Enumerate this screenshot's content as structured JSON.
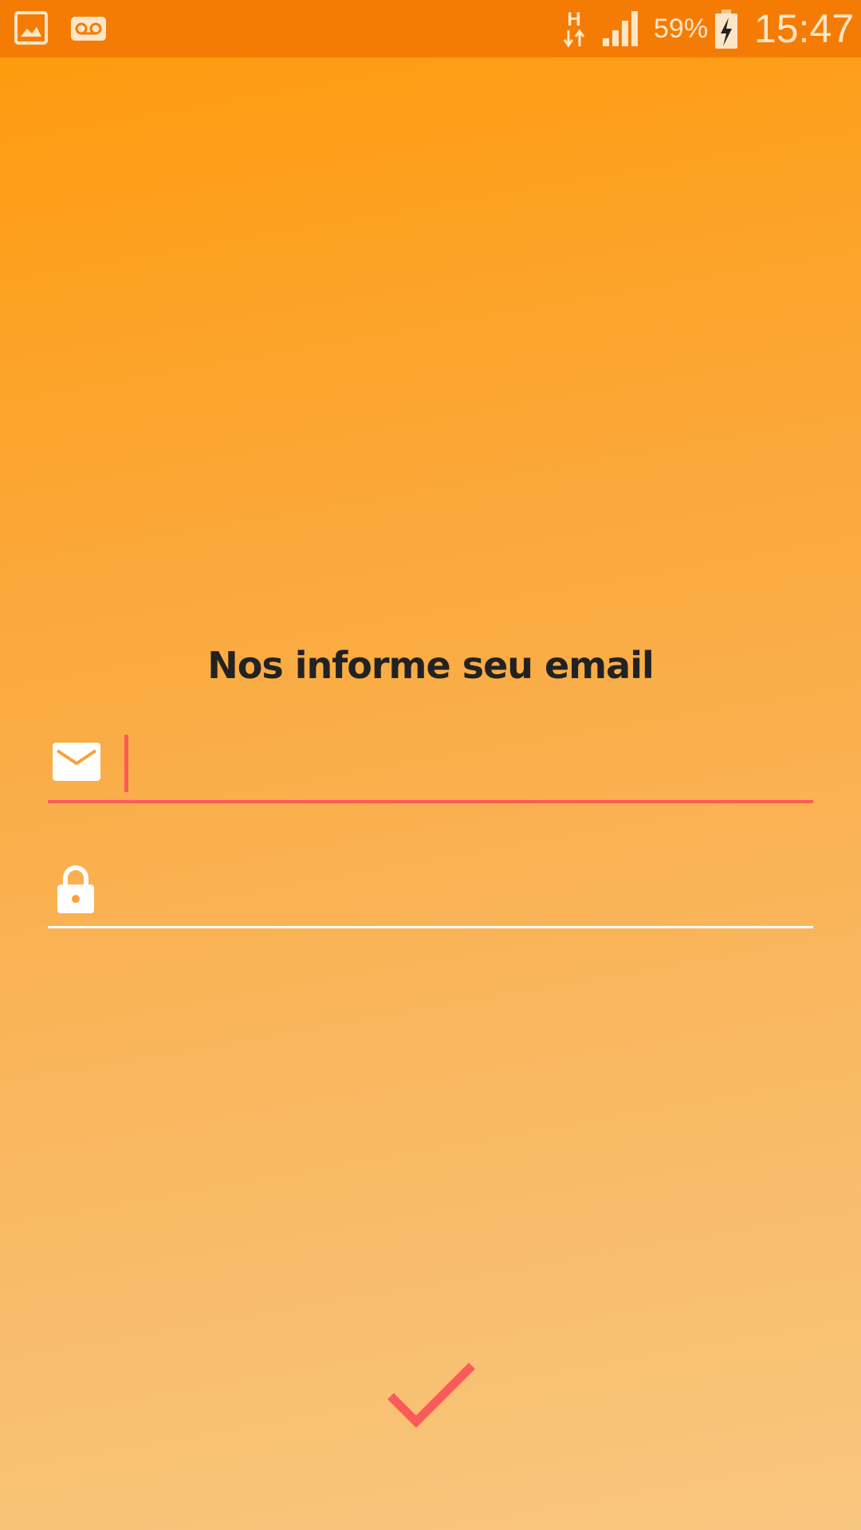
{
  "status_bar": {
    "battery_percent": "59%",
    "clock": "15:47",
    "network_type": "H",
    "icons": [
      "gallery-icon",
      "voicemail-icon",
      "network-h-icon",
      "signal-icon",
      "battery-charging-icon"
    ]
  },
  "form": {
    "title": "Nos informe seu email",
    "email": {
      "icon": "mail-icon",
      "value": "",
      "placeholder": ""
    },
    "password": {
      "icon": "lock-icon",
      "value": "",
      "placeholder": ""
    },
    "submit_icon": "checkmark-icon"
  },
  "colors": {
    "status_bar": "#f57c04",
    "gradient_top": "#ff9a0a",
    "gradient_bottom": "#f8c77f",
    "accent": "#fb5a5a",
    "title_text": "#222222"
  }
}
